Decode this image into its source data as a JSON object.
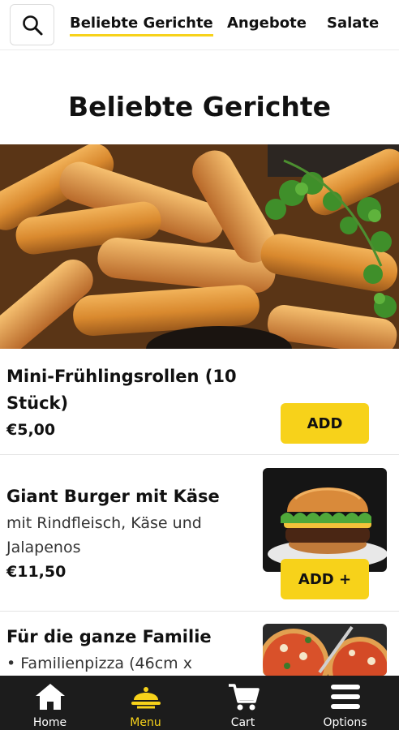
{
  "header": {
    "search_icon": "search-icon",
    "tabs": [
      {
        "label": "Beliebte Gerichte",
        "active": true
      },
      {
        "label": "Angebote",
        "active": false
      },
      {
        "label": "Salate",
        "active": false
      }
    ]
  },
  "section": {
    "title": "Beliebte Gerichte"
  },
  "items": [
    {
      "name_line1": "Mini-Frühlingsrollen (10",
      "name_line2": "Stück)",
      "price": "€5,00",
      "button": "ADD"
    },
    {
      "name": "Giant Burger mit Käse",
      "desc_line1": "mit Rindfleisch, Käse und",
      "desc_line2": "Jalapenos",
      "price": "€11,50",
      "button": "ADD +"
    },
    {
      "name": "Für die ganze Familie",
      "desc_line1": "• Familienpizza (46cm x"
    }
  ],
  "bottom_nav": [
    {
      "label": "Home",
      "icon": "home-icon"
    },
    {
      "label": "Menu",
      "icon": "menu-icon",
      "active": true
    },
    {
      "label": "Cart",
      "icon": "cart-icon"
    },
    {
      "label": "Options",
      "icon": "options-icon"
    }
  ],
  "colors": {
    "accent": "#f7d21a",
    "nav_bg": "#1c1c1c"
  }
}
